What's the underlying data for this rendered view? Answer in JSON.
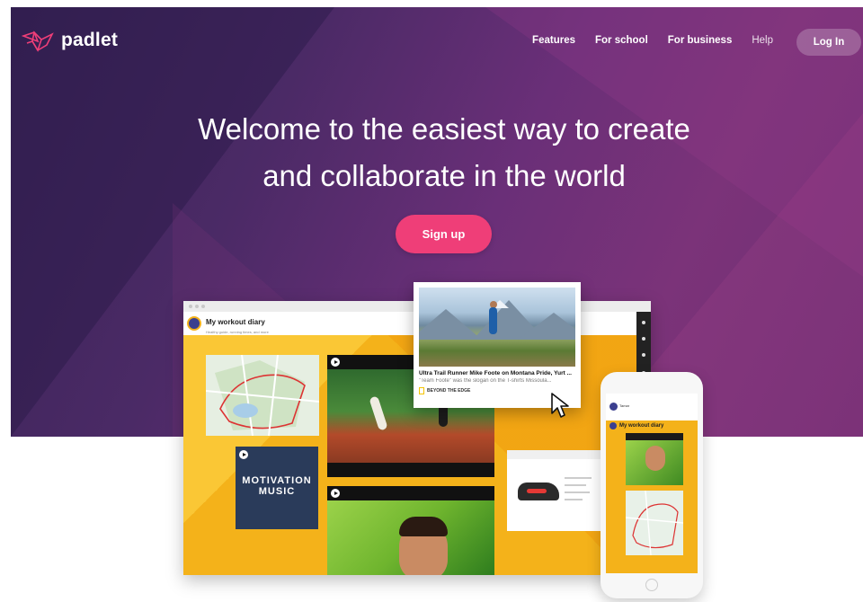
{
  "brand": {
    "name": "padlet",
    "primary_color": "#ef3e78",
    "hero_color": "#5a2c6e"
  },
  "nav": {
    "links": [
      {
        "label": "Features"
      },
      {
        "label": "For school"
      },
      {
        "label": "For business"
      },
      {
        "label": "Help"
      }
    ],
    "login_label": "Log In"
  },
  "hero": {
    "headline_line1": "Welcome to the easiest way to create",
    "headline_line2": "and collaborate in the world",
    "cta_label": "Sign up"
  },
  "board": {
    "title": "My workout diary",
    "subtitle": "Healthy guide, running times, and more",
    "music_card_text": "MOTIVATION MUSIC"
  },
  "article": {
    "title": "Ultra Trail Runner Mike Foote on Montana Pride, Yurt ...",
    "snippet": "\"Team Foote\" was the slogan on the T-shirts Missoula...",
    "source": "BEYOND THE EDGE"
  },
  "phone": {
    "user_name": "Tamar",
    "board_title": "My workout diary"
  },
  "icons": [
    "padlet-logo-icon",
    "play-icon",
    "cursor-icon",
    "national-geographic-icon"
  ]
}
